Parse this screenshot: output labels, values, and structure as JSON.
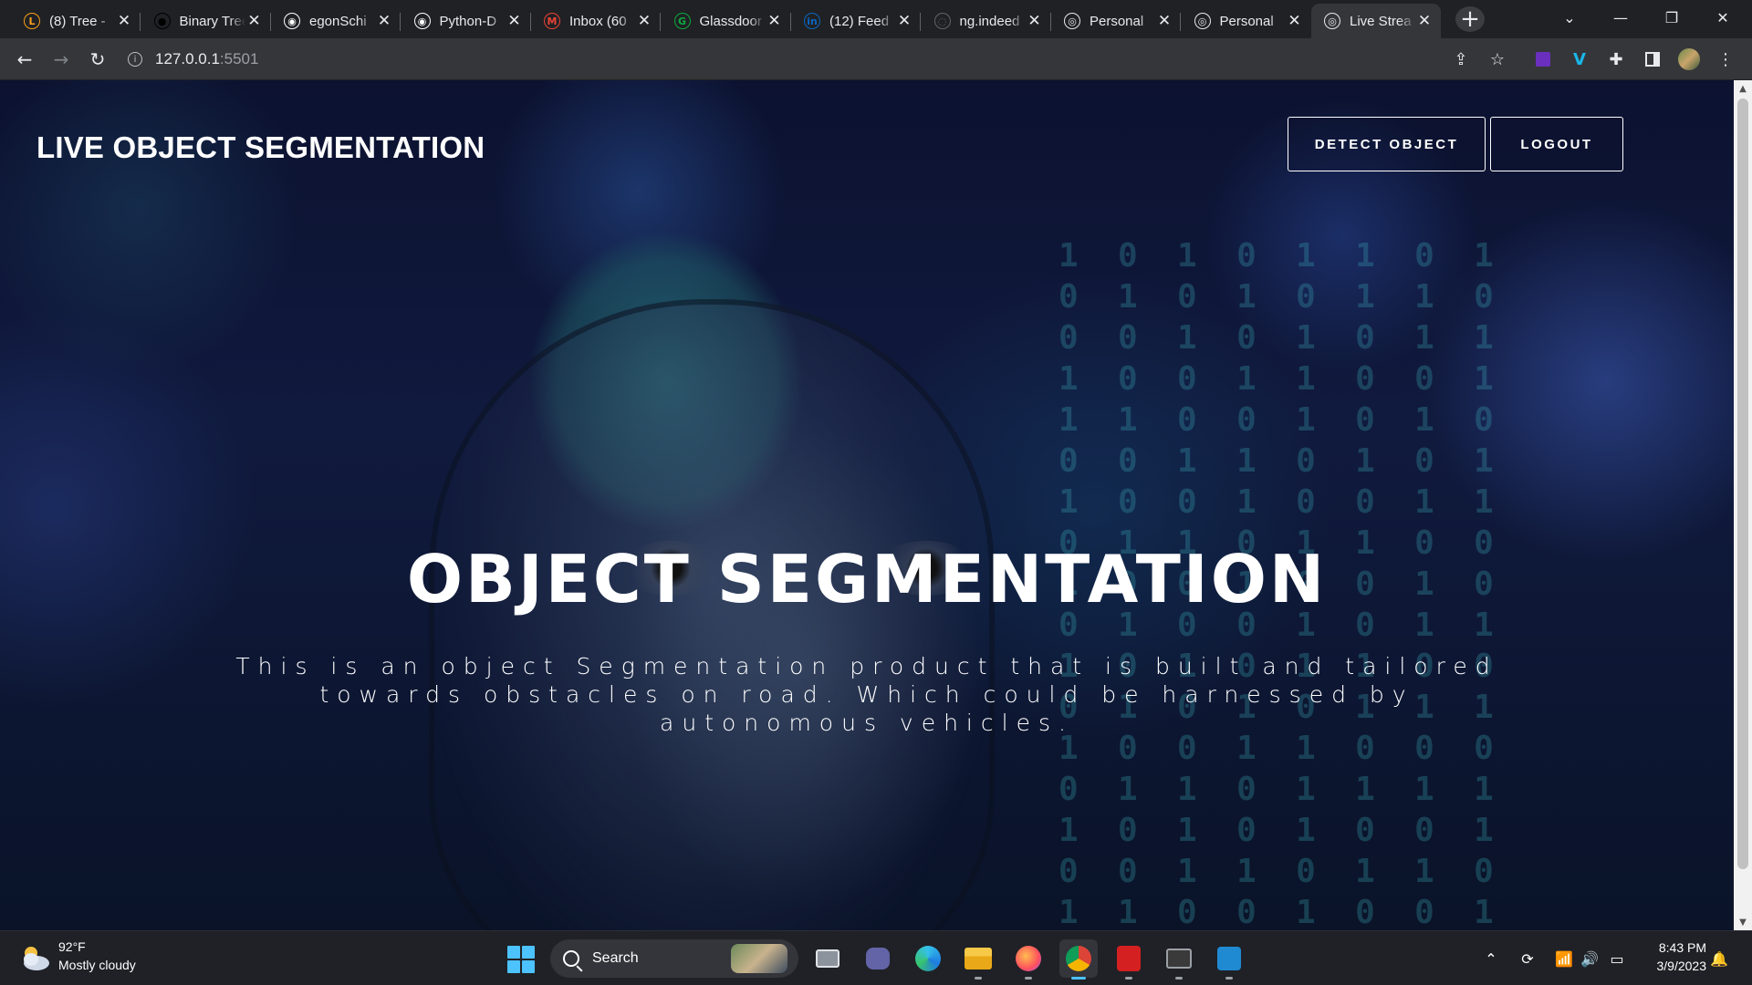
{
  "browser": {
    "tabs": [
      {
        "label": "(8) Tree - ",
        "icon": "leetcode-icon",
        "color": "#f89f1b"
      },
      {
        "label": "Binary Tree",
        "icon": "medium-icon",
        "color": "#000000"
      },
      {
        "label": "egonSchi",
        "icon": "github-icon",
        "color": "#ffffff"
      },
      {
        "label": "Python-D",
        "icon": "github-icon",
        "color": "#ffffff"
      },
      {
        "label": "Inbox (60",
        "icon": "gmail-icon",
        "color": "#ea4335"
      },
      {
        "label": "Glassdoor",
        "icon": "glassdoor-icon",
        "color": "#0caa41"
      },
      {
        "label": "(12) Feed",
        "icon": "linkedin-icon",
        "color": "#0a66c2"
      },
      {
        "label": "ng.indeed",
        "icon": "loading-icon",
        "color": "#5f6368"
      },
      {
        "label": "Personal",
        "icon": "globe-icon",
        "color": "#e8eaed"
      },
      {
        "label": "Personal",
        "icon": "globe-icon",
        "color": "#e8eaed"
      },
      {
        "label": "Live Strea",
        "icon": "globe-icon",
        "color": "#e8eaed"
      }
    ],
    "url_host": "127.0.0.1",
    "url_port": ":5501"
  },
  "page": {
    "brand": "LIVE OBJECT SEGMENTATION",
    "nav": {
      "detect_label": "DETECT OBJECT",
      "logout_label": "LOGOUT"
    },
    "hero_title": "OBJECT SEGMENTATION",
    "hero_text": "This is an object Segmentation product that is built and tailored towards obstacles on road. Which could be harnessed by autonomous vehicles.",
    "accent_color": "#ffffff"
  },
  "taskbar": {
    "weather_temp": "92°F",
    "weather_desc": "Mostly cloudy",
    "search_label": "Search",
    "time": "8:43 PM",
    "date": "3/9/2023"
  }
}
